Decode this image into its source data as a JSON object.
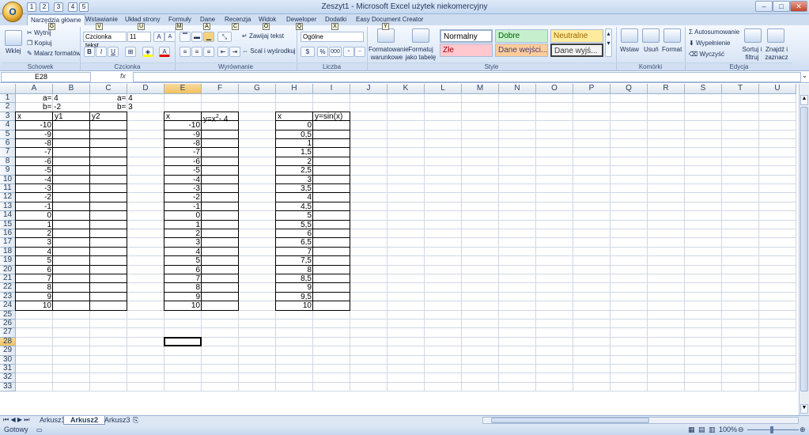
{
  "window": {
    "title": "Zeszyt1 - Microsoft Excel użytek niekomercyjny",
    "office_button_label": "O",
    "qat_keytips": [
      "1",
      "2",
      "3",
      "4",
      "5"
    ]
  },
  "ribbon_tabs": [
    {
      "label": "Narzędzia główne",
      "key": "G",
      "active": true
    },
    {
      "label": "Wstawianie",
      "key": "V"
    },
    {
      "label": "Układ strony",
      "key": "U"
    },
    {
      "label": "Formuły",
      "key": "M"
    },
    {
      "label": "Dane",
      "key": "A"
    },
    {
      "label": "Recenzja",
      "key": "C"
    },
    {
      "label": "Widok",
      "key": "O"
    },
    {
      "label": "Deweloper",
      "key": "Q"
    },
    {
      "label": "Dodatki",
      "key": "X"
    },
    {
      "label": "Easy Document Creator",
      "key": "Y"
    }
  ],
  "clipboard": {
    "paste": "Wklej",
    "cut": "Wytnij",
    "copy": "Kopiuj",
    "format_painter": "Malarz formatów",
    "group": "Schowek"
  },
  "font": {
    "name": "Czcionka tekst",
    "size": "11",
    "bold": "B",
    "italic": "I",
    "underline": "U",
    "font_color_label": "A",
    "grow": "A",
    "shrink": "A",
    "group": "Czcionka"
  },
  "alignment": {
    "wrap": "Zawijaj tekst",
    "merge": "Scal i wyśrodkuj",
    "group": "Wyrównanie"
  },
  "number": {
    "format": "Ogólne",
    "currency": "$",
    "percent": "%",
    "thousands": "000",
    "group": "Liczba"
  },
  "styles": {
    "cond_format": "Formatowanie warunkowe",
    "format_table": "Formatuj jako tabelę",
    "cells": [
      {
        "label": "Normalny",
        "bg": "#ffffff",
        "fg": "#000000"
      },
      {
        "label": "Dobre",
        "bg": "#c6efce",
        "fg": "#006100"
      },
      {
        "label": "Neutralne",
        "bg": "#ffeb9c",
        "fg": "#9c6500"
      },
      {
        "label": "Złe",
        "bg": "#ffc7ce",
        "fg": "#9c0006"
      },
      {
        "label": "Dane wejści...",
        "bg": "#ffcc99",
        "fg": "#3f3f76"
      },
      {
        "label": "Dane wyjś...",
        "bg": "#f2f2f2",
        "fg": "#3f3f3f"
      }
    ],
    "group": "Style"
  },
  "cells_group": {
    "insert": "Wstaw",
    "delete": "Usuń",
    "format": "Format",
    "group": "Komórki"
  },
  "editing": {
    "autosum": "Autosumowanie",
    "fill": "Wypełnienie",
    "clear": "Wyczyść",
    "sort": "Sortuj i filtruj",
    "find": "Znajdź i zaznacz",
    "group": "Edycja"
  },
  "formula_bar": {
    "name_box": "E28",
    "fx": "fx",
    "value": ""
  },
  "columns": [
    "A",
    "B",
    "C",
    "D",
    "E",
    "F",
    "G",
    "H",
    "I",
    "J",
    "K",
    "L",
    "M",
    "N",
    "O",
    "P",
    "Q",
    "R",
    "S",
    "T",
    "U"
  ],
  "rows": [
    "1",
    "2",
    "3",
    "4",
    "5",
    "6",
    "7",
    "8",
    "9",
    "10",
    "11",
    "12",
    "13",
    "14",
    "15",
    "16",
    "17",
    "18",
    "19",
    "20",
    "21",
    "22",
    "23",
    "24",
    "25",
    "26",
    "27",
    "28",
    "29",
    "30",
    "31",
    "32",
    "33"
  ],
  "selected_cell": {
    "col": "E",
    "row": "28"
  },
  "cells_text": {
    "a1": "a= 4",
    "b1": "b= -2",
    "a2": "a= 4",
    "b2": "b= 3",
    "x": "x",
    "y1": "y1",
    "y2": "y2",
    "fx_label": "x",
    "fx_head": "y=x",
    "fx_sup": "2",
    "fx_tail": "- 4",
    "sx_label": "x",
    "sin_head": "y=sin(x)"
  },
  "col_a_values": [
    "-10",
    "-9",
    "-8",
    "-7",
    "-6",
    "-5",
    "-4",
    "-3",
    "-2",
    "-1",
    "0",
    "1",
    "2",
    "3",
    "4",
    "5",
    "6",
    "7",
    "8",
    "9",
    "10"
  ],
  "col_h_values": [
    "0",
    "0,5",
    "1",
    "1,5",
    "2",
    "2,5",
    "3",
    "3,5",
    "4",
    "4,5",
    "5",
    "5,5",
    "6",
    "6,5",
    "7",
    "7,5",
    "8",
    "8,5",
    "9",
    "9,5",
    "10"
  ],
  "sheets": [
    "Arkusz1",
    "Arkusz2",
    "Arkusz3"
  ],
  "active_sheet": "Arkusz2",
  "status": {
    "ready": "Gotowy",
    "zoom": "100%"
  }
}
